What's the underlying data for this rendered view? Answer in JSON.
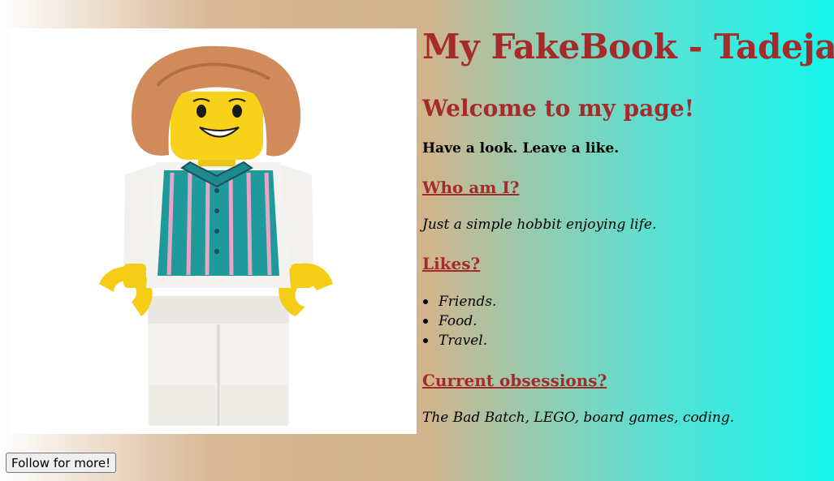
{
  "page": {
    "title": "My FakeBook - Tadeja S",
    "welcome": "Welcome to my page!",
    "lead": "Have a look. Leave a like."
  },
  "sections": {
    "who": {
      "heading": "Who am I?",
      "text": "Just a simple hobbit enjoying life."
    },
    "likes": {
      "heading": "Likes?",
      "items": [
        "Friends.",
        "Food.",
        "Travel."
      ]
    },
    "obsessions": {
      "heading": "Current obsessions?",
      "text": "The Bad Batch, LEGO, board games, coding."
    }
  },
  "follow_button": {
    "label": "Follow for more!"
  },
  "profile_image": {
    "subject": "lego-minifigure"
  },
  "colors": {
    "heading": "#a52a2a",
    "text": "#000000"
  }
}
